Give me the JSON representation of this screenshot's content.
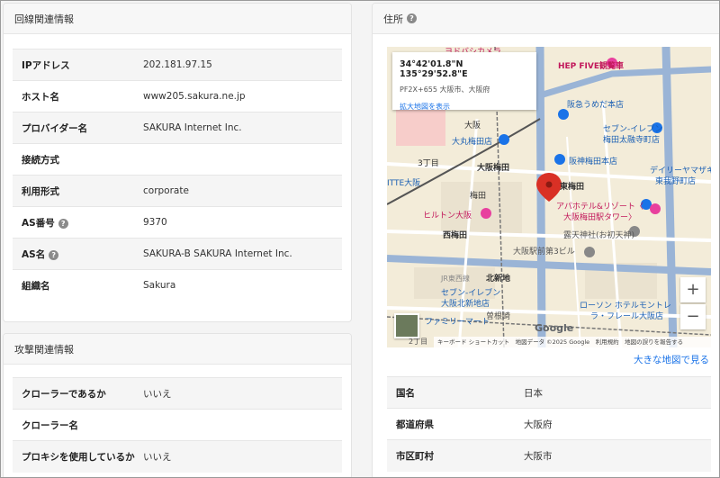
{
  "line_info": {
    "title": "回線関連情報",
    "rows": [
      {
        "key": "IPアドレス",
        "value": "202.181.97.15",
        "help": false
      },
      {
        "key": "ホスト名",
        "value": "www205.sakura.ne.jp",
        "help": false
      },
      {
        "key": "プロバイダー名",
        "value": "SAKURA Internet Inc.",
        "help": false
      },
      {
        "key": "接続方式",
        "value": "",
        "help": false
      },
      {
        "key": "利用形式",
        "value": "corporate",
        "help": false
      },
      {
        "key": "AS番号",
        "value": "9370",
        "help": true
      },
      {
        "key": "AS名",
        "value": "SAKURA-B SAKURA Internet Inc.",
        "help": true
      },
      {
        "key": "組織名",
        "value": "Sakura",
        "help": false
      }
    ]
  },
  "attack_info": {
    "title": "攻撃関連情報",
    "rows": [
      {
        "key": "クローラーであるか",
        "value": "いいえ"
      },
      {
        "key": "クローラー名",
        "value": ""
      },
      {
        "key": "プロキシを使用しているか",
        "value": "いいえ"
      }
    ]
  },
  "address": {
    "title": "住所",
    "help_icon": "question-circle-icon",
    "map": {
      "coords": "34°42'01.8\"N 135°29'52.8\"E",
      "plus_code": "PF2X+655 大阪市、大阪府",
      "enlarge_link": "拡大地図を表示",
      "zoom_in": "+",
      "zoom_out": "−",
      "google_logo": "Google",
      "footer": "キーボード ショートカット　地図データ ©2025 Google　利用規約　地図の誤りを報告する",
      "labels": {
        "hepfive": "HEP FIVE観覧車",
        "yodobashi": "ヨドバシカメラ",
        "hankyu_umeda": "阪急うめだ本店",
        "osaka_station": "大阪",
        "daimaru": "大丸梅田店",
        "eleven_a": "セブン-イレブン",
        "eleven_a2": "梅田太融寺町店",
        "osaka_umeda": "大阪梅田",
        "hanshin": "阪神梅田本店",
        "sanchome": "3丁目",
        "daily": "デイリーヤマザキ",
        "daily2": "東我野町店",
        "itte": "ITTE大阪",
        "higashi_umeda": "東梅田",
        "umeda": "梅田",
        "apa": "アパホテル&リゾート〈",
        "apa2": "大阪梅田駅タワー〉",
        "hilton": "ヒルトン大阪",
        "nishi_umeda": "西梅田",
        "tsuyu": "露天神社(お初天神)",
        "ekimae": "大阪駅前第3ビル",
        "kitashinchi": "北新地",
        "eleven_b": "セブン-イレブン",
        "eleven_b2": "大阪北新地店",
        "lawson": "ローソン ホテルモントレ",
        "lawson2": "ラ・フレール大阪店",
        "family": "ファミリーマート",
        "sonezaki": "曽根崎",
        "nichome": "2丁目",
        "jrnishi": "JR東西線"
      }
    },
    "bigger_map_link": "大きな地図で見る",
    "rows": [
      {
        "key": "国名",
        "value": "日本"
      },
      {
        "key": "都道府県",
        "value": "大阪府"
      },
      {
        "key": "市区町村",
        "value": "大阪市"
      }
    ]
  },
  "colors": {
    "link": "#1a73e8",
    "map_road_major": "#9ab4d6",
    "map_pin": "#d93025",
    "map_bg": "#f3ecd9"
  }
}
